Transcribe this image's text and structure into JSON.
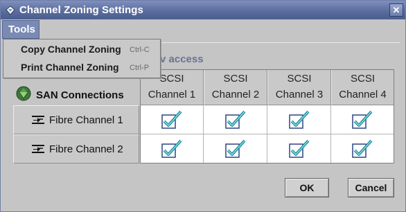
{
  "window": {
    "title": "Channel Zoning Settings",
    "close_symbol": "✕"
  },
  "menubar": {
    "tools_label": "Tools"
  },
  "tools_menu": {
    "items": [
      {
        "label": "Copy Channel Zoning",
        "accelerator": "Ctrl-C"
      },
      {
        "label": "Print Channel Zoning",
        "accelerator": "Ctrl-P"
      }
    ]
  },
  "panel": {
    "legend_fragment": "v access"
  },
  "grid": {
    "corner_label": "SAN Connections",
    "columns": [
      {
        "line1": "SCSI",
        "line2": "Channel 1"
      },
      {
        "line1": "SCSI",
        "line2": "Channel 2"
      },
      {
        "line1": "SCSI",
        "line2": "Channel 3"
      },
      {
        "line1": "SCSI",
        "line2": "Channel 4"
      }
    ],
    "rows": [
      {
        "label": "Fibre Channel 1",
        "checked": [
          true,
          true,
          true,
          true
        ]
      },
      {
        "label": "Fibre Channel 2",
        "checked": [
          true,
          true,
          true,
          true
        ]
      }
    ]
  },
  "buttons": {
    "ok": "OK",
    "cancel": "Cancel"
  },
  "colors": {
    "titlebar": "#5b6d9e",
    "check": "#1e8ea0",
    "checkbox_border": "#3a4f86"
  }
}
